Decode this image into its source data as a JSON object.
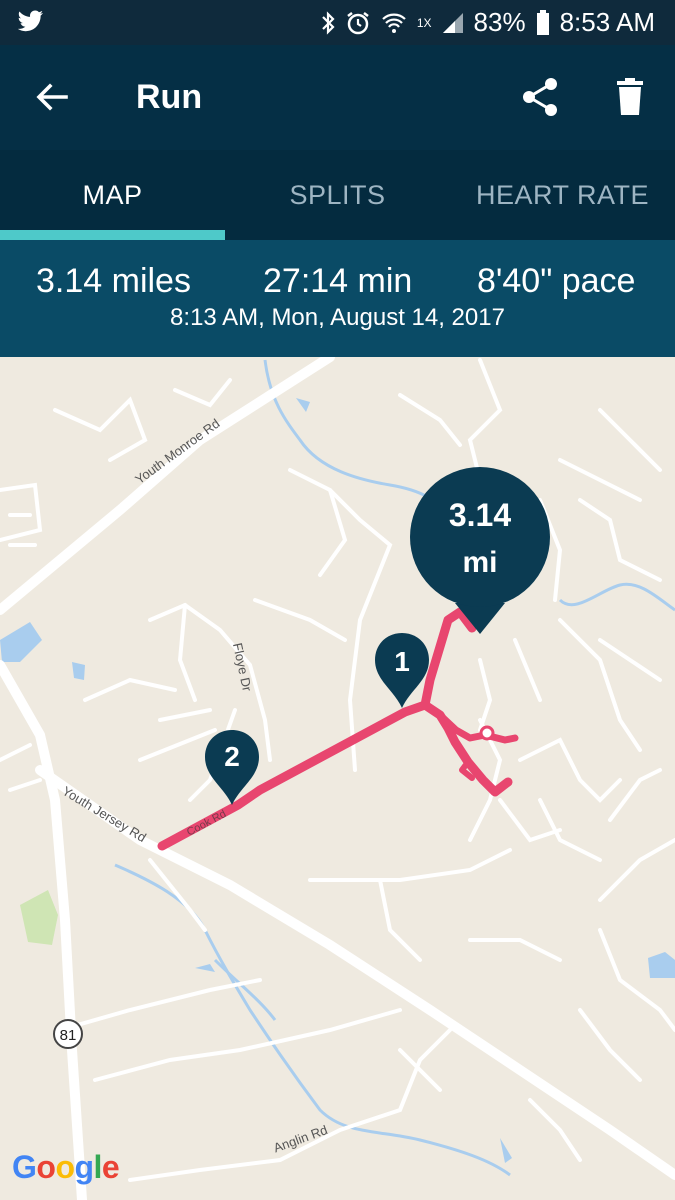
{
  "status_bar": {
    "battery": "83%",
    "time": "8:53 AM",
    "network_label": "1X",
    "icons": [
      "twitter-icon",
      "bluetooth-icon",
      "alarm-icon",
      "wifi-icon",
      "signal-icon",
      "battery-icon"
    ]
  },
  "app_bar": {
    "title": "Run",
    "icons": [
      "back-arrow-icon",
      "share-icon",
      "trash-icon"
    ]
  },
  "tabs": [
    {
      "label": "MAP",
      "active": true
    },
    {
      "label": "SPLITS",
      "active": false
    },
    {
      "label": "HEART RATE",
      "active": false
    }
  ],
  "summary": {
    "distance": "3.14 miles",
    "duration": "27:14 min",
    "pace": "8'40\" pace",
    "datetime": "8:13 AM, Mon, August 14, 2017"
  },
  "map": {
    "roads": {
      "youth_monroe": "Youth Monroe Rd",
      "floye": "Floye Dr",
      "youth_jersey": "Youth Jersey Rd",
      "cook": "Cook Rd",
      "anglin": "Anglin Rd"
    },
    "route_shield": "81",
    "end_marker_value": "3.14",
    "end_marker_unit": "mi",
    "split_markers": [
      "1",
      "2"
    ],
    "attribution": "Google",
    "route_color": "#e8466f",
    "marker_color": "#0b3b52"
  }
}
